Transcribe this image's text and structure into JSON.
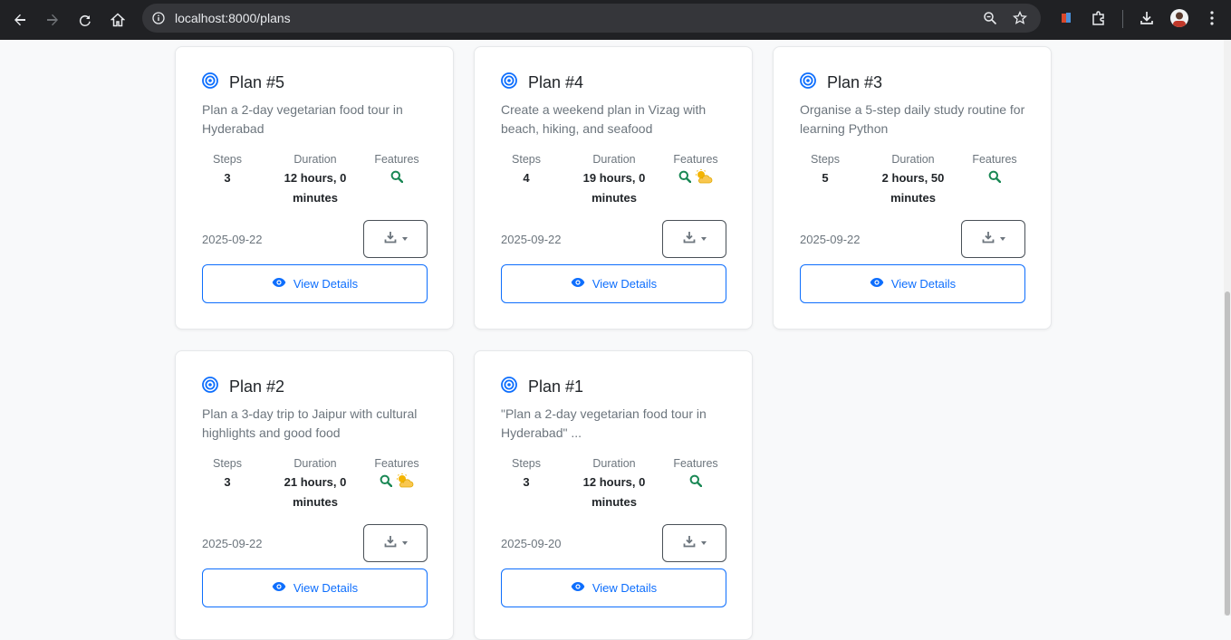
{
  "browser": {
    "url": "localhost:8000/plans",
    "colors": {
      "bar": "#202124",
      "omnibox": "#35363a",
      "text": "#e8eaed"
    }
  },
  "labels": {
    "steps": "Steps",
    "duration": "Duration",
    "features": "Features",
    "view_details": "View Details"
  },
  "colors": {
    "primary": "#0d6efd",
    "feature_search": "#198754",
    "feature_weather": "#f4b400"
  },
  "plans": [
    {
      "title": "Plan #5",
      "description": "Plan a 2-day vegetarian food tour in Hyderabad",
      "steps": "3",
      "duration": "12 hours, 0 minutes",
      "features": [
        "search-icon"
      ],
      "date": "2025-09-22"
    },
    {
      "title": "Plan #4",
      "description": "Create a weekend plan in Vizag with beach, hiking, and seafood",
      "steps": "4",
      "duration": "19 hours, 0 minutes",
      "features": [
        "search-icon",
        "weather-icon"
      ],
      "date": "2025-09-22"
    },
    {
      "title": "Plan #3",
      "description": "Organise a 5-step daily study routine for learning Python",
      "steps": "5",
      "duration": "2 hours, 50 minutes",
      "features": [
        "search-icon"
      ],
      "date": "2025-09-22"
    },
    {
      "title": "Plan #2",
      "description": "Plan a 3-day trip to Jaipur with cultural highlights and good food",
      "steps": "3",
      "duration": "21 hours, 0 minutes",
      "features": [
        "search-icon",
        "weather-icon"
      ],
      "date": "2025-09-22"
    },
    {
      "title": "Plan #1",
      "description": "\"Plan a 2-day vegetarian food tour in Hyderabad\" ...",
      "steps": "3",
      "duration": "12 hours, 0 minutes",
      "features": [
        "search-icon"
      ],
      "date": "2025-09-20"
    }
  ]
}
